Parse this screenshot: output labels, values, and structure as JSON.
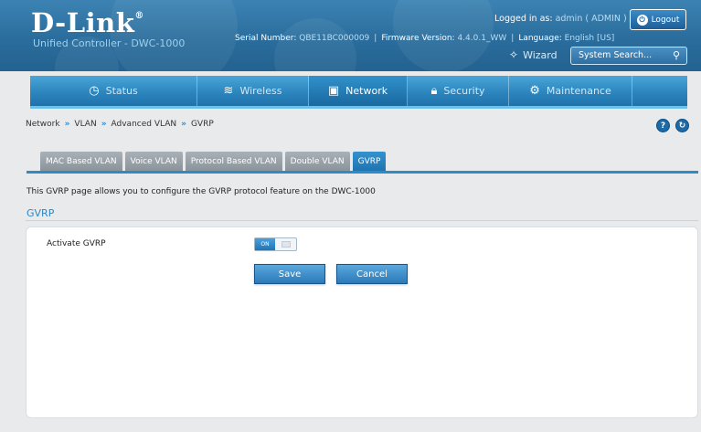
{
  "header": {
    "brand": "D-Link",
    "brand_mark": "®",
    "subtitle": "Unified Controller - DWC-1000",
    "login_label": "Logged in as:",
    "login_value": "admin ( ADMIN )",
    "logout_label": "Logout",
    "serial_label": "Serial Number:",
    "serial_value": "QBE11BC000009",
    "firmware_label": "Firmware Version:",
    "firmware_value": "4.4.0.1_WW",
    "language_label": "Language:",
    "language_value": "English [US]",
    "separator": "|",
    "wizard_label": "Wizard",
    "search_placeholder": "System Search..."
  },
  "nav": {
    "items": [
      {
        "label": "Status",
        "icon": "gauge-icon"
      },
      {
        "label": "Wireless",
        "icon": "wifi-icon"
      },
      {
        "label": "Network",
        "icon": "monitor-icon",
        "active": true
      },
      {
        "label": "Security",
        "icon": "lock-icon"
      },
      {
        "label": "Maintenance",
        "icon": "gears-icon"
      }
    ]
  },
  "breadcrumb": [
    "Network",
    "VLAN",
    "Advanced VLAN",
    "GVRP"
  ],
  "breadcrumb_separator": "»",
  "tabs": [
    {
      "label": "MAC Based VLAN"
    },
    {
      "label": "Voice VLAN"
    },
    {
      "label": "Protocol Based VLAN"
    },
    {
      "label": "Double VLAN"
    },
    {
      "label": "GVRP",
      "active": true
    }
  ],
  "main": {
    "intro": "This GVRP page allows you to configure the GVRP protocol feature on the DWC-1000",
    "section_title": "GVRP",
    "activate_label": "Activate GVRP",
    "toggle_on_label": "ON",
    "toggle_state": "on",
    "save_label": "Save",
    "cancel_label": "Cancel"
  },
  "colors": {
    "header_blue": "#2a6d9c",
    "accent_blue": "#2d86c4",
    "tab_active": "#1f74b1",
    "tab_inactive": "#8b949b"
  }
}
